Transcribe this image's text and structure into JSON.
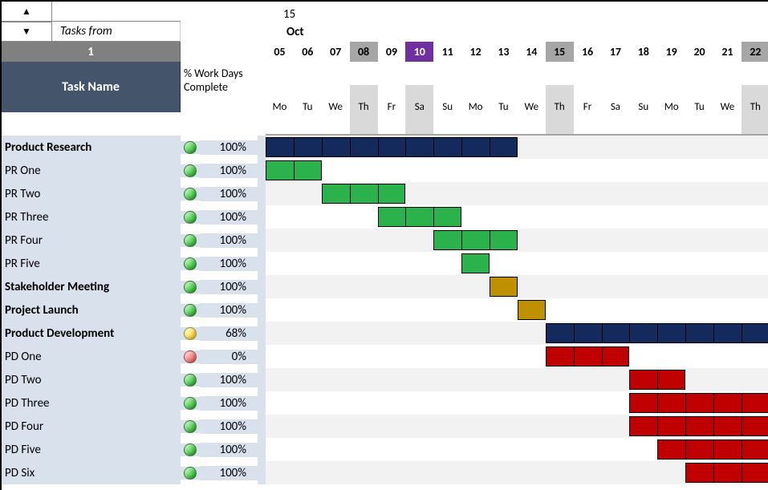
{
  "header": {
    "tasks_from": "Tasks from",
    "week_number": "1",
    "task_name_header": "Task Name",
    "pct_header_l1": "% Work Days",
    "pct_header_l2": "Complete",
    "top_number": "15",
    "month": "Oct"
  },
  "days": [
    "05",
    "06",
    "07",
    "08",
    "09",
    "10",
    "11",
    "12",
    "13",
    "14",
    "15",
    "16",
    "17",
    "18",
    "19",
    "20",
    "21",
    "22"
  ],
  "day_special": {
    "08": "gray",
    "10": "purple",
    "15": "gray",
    "22": "gray"
  },
  "dows": [
    "Mo",
    "Tu",
    "We",
    "Th",
    "Fr",
    "Sa",
    "Su",
    "Mo",
    "Tu",
    "We",
    "Th",
    "Fr",
    "Sa",
    "Su",
    "Mo",
    "Tu",
    "We",
    "Th"
  ],
  "dow_gray": [
    false,
    false,
    false,
    true,
    false,
    true,
    false,
    false,
    false,
    false,
    true,
    false,
    false,
    false,
    false,
    false,
    false,
    true
  ],
  "tasks": [
    {
      "name": "Product Research",
      "bold": true,
      "status": "green",
      "pct": "100%",
      "bars": [
        {
          "color": "navy",
          "start": 0,
          "span": 9
        }
      ]
    },
    {
      "name": "PR One",
      "bold": false,
      "status": "green",
      "pct": "100%",
      "bars": [
        {
          "color": "green",
          "start": 0,
          "span": 2
        }
      ]
    },
    {
      "name": "PR Two",
      "bold": false,
      "status": "green",
      "pct": "100%",
      "bars": [
        {
          "color": "green",
          "start": 2,
          "span": 3
        }
      ]
    },
    {
      "name": "PR Three",
      "bold": false,
      "status": "green",
      "pct": "100%",
      "bars": [
        {
          "color": "green",
          "start": 4,
          "span": 3
        }
      ]
    },
    {
      "name": "PR Four",
      "bold": false,
      "status": "green",
      "pct": "100%",
      "bars": [
        {
          "color": "green",
          "start": 6,
          "span": 3
        }
      ]
    },
    {
      "name": "PR Five",
      "bold": false,
      "status": "green",
      "pct": "100%",
      "bars": [
        {
          "color": "green",
          "start": 7,
          "span": 1
        }
      ]
    },
    {
      "name": "Stakeholder Meeting",
      "bold": true,
      "status": "green",
      "pct": "100%",
      "bars": [
        {
          "color": "gold",
          "start": 8,
          "span": 1
        }
      ]
    },
    {
      "name": "Project Launch",
      "bold": true,
      "status": "green",
      "pct": "100%",
      "bars": [
        {
          "color": "gold",
          "start": 9,
          "span": 1
        }
      ]
    },
    {
      "name": "Product Development",
      "bold": true,
      "status": "yellow",
      "pct": "68%",
      "bars": [
        {
          "color": "navy",
          "start": 10,
          "span": 8
        }
      ]
    },
    {
      "name": "PD One",
      "bold": false,
      "status": "red",
      "pct": "0%",
      "bars": [
        {
          "color": "red",
          "start": 10,
          "span": 3
        }
      ]
    },
    {
      "name": "PD Two",
      "bold": false,
      "status": "green",
      "pct": "100%",
      "bars": [
        {
          "color": "red",
          "start": 13,
          "span": 2
        }
      ]
    },
    {
      "name": "PD Three",
      "bold": false,
      "status": "green",
      "pct": "100%",
      "bars": [
        {
          "color": "red",
          "start": 13,
          "span": 5
        }
      ]
    },
    {
      "name": "PD Four",
      "bold": false,
      "status": "green",
      "pct": "100%",
      "bars": [
        {
          "color": "red",
          "start": 13,
          "span": 5
        }
      ]
    },
    {
      "name": "PD Five",
      "bold": false,
      "status": "green",
      "pct": "100%",
      "bars": [
        {
          "color": "red",
          "start": 14,
          "span": 4
        }
      ]
    },
    {
      "name": "PD Six",
      "bold": false,
      "status": "green",
      "pct": "100%",
      "bars": [
        {
          "color": "red",
          "start": 15,
          "span": 3
        }
      ]
    }
  ],
  "chart_data": {
    "type": "gantt",
    "title": "",
    "x_unit": "days",
    "x_start": "Oct 05",
    "categories": [
      "05",
      "06",
      "07",
      "08",
      "09",
      "10",
      "11",
      "12",
      "13",
      "14",
      "15",
      "16",
      "17",
      "18",
      "19",
      "20",
      "21",
      "22"
    ],
    "series": [
      {
        "name": "Product Research",
        "type": "summary",
        "start_index": 0,
        "duration_days": 9,
        "pct_complete": 100,
        "status": "green"
      },
      {
        "name": "PR One",
        "type": "task",
        "start_index": 0,
        "duration_days": 2,
        "pct_complete": 100,
        "status": "green"
      },
      {
        "name": "PR Two",
        "type": "task",
        "start_index": 2,
        "duration_days": 3,
        "pct_complete": 100,
        "status": "green"
      },
      {
        "name": "PR Three",
        "type": "task",
        "start_index": 4,
        "duration_days": 3,
        "pct_complete": 100,
        "status": "green"
      },
      {
        "name": "PR Four",
        "type": "task",
        "start_index": 6,
        "duration_days": 3,
        "pct_complete": 100,
        "status": "green"
      },
      {
        "name": "PR Five",
        "type": "task",
        "start_index": 7,
        "duration_days": 1,
        "pct_complete": 100,
        "status": "green"
      },
      {
        "name": "Stakeholder Meeting",
        "type": "milestone",
        "start_index": 8,
        "duration_days": 1,
        "pct_complete": 100,
        "status": "green"
      },
      {
        "name": "Project Launch",
        "type": "milestone",
        "start_index": 9,
        "duration_days": 1,
        "pct_complete": 100,
        "status": "green"
      },
      {
        "name": "Product Development",
        "type": "summary",
        "start_index": 10,
        "duration_days": 8,
        "pct_complete": 68,
        "status": "yellow"
      },
      {
        "name": "PD One",
        "type": "task",
        "start_index": 10,
        "duration_days": 3,
        "pct_complete": 0,
        "status": "red"
      },
      {
        "name": "PD Two",
        "type": "task",
        "start_index": 13,
        "duration_days": 2,
        "pct_complete": 100,
        "status": "green"
      },
      {
        "name": "PD Three",
        "type": "task",
        "start_index": 13,
        "duration_days": 5,
        "pct_complete": 100,
        "status": "green"
      },
      {
        "name": "PD Four",
        "type": "task",
        "start_index": 13,
        "duration_days": 5,
        "pct_complete": 100,
        "status": "green"
      },
      {
        "name": "PD Five",
        "type": "task",
        "start_index": 14,
        "duration_days": 4,
        "pct_complete": 100,
        "status": "green"
      },
      {
        "name": "PD Six",
        "type": "task",
        "start_index": 15,
        "duration_days": 3,
        "pct_complete": 100,
        "status": "green"
      }
    ]
  }
}
